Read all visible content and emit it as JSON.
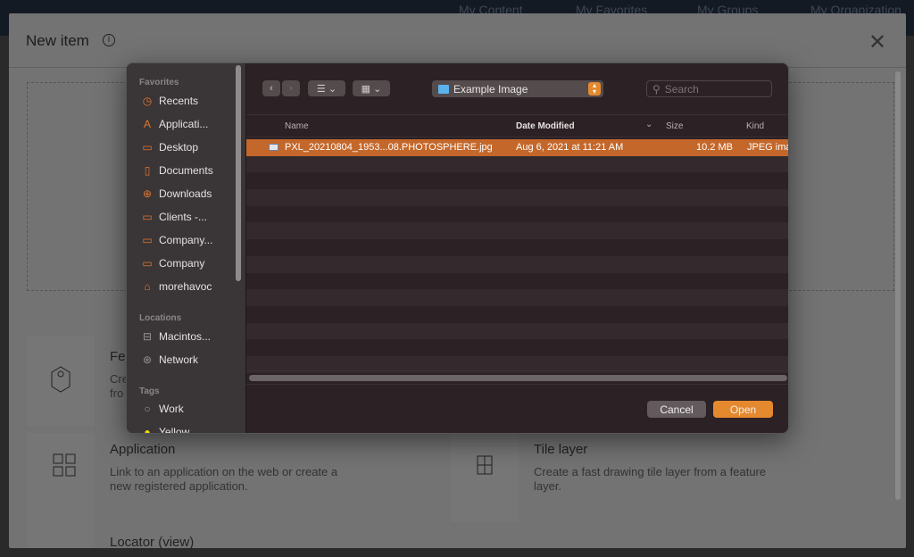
{
  "top_nav": [
    "My Content",
    "My Favorites",
    "My Groups",
    "My Organization"
  ],
  "modal": {
    "title": "New item",
    "info_icon": "info-icon",
    "close_icon": "close-icon",
    "cards": [
      {
        "title": "Fe",
        "desc": "Cre\nfro",
        "icon": "map-pin-icon"
      },
      {
        "title": "Application",
        "desc": "Link to an application on the web or create a new registered application.",
        "icon": "grid-icon"
      },
      {
        "title": "Tile layer",
        "desc": "Create a fast drawing tile layer from a feature layer.",
        "icon": "tile-map-icon"
      },
      {
        "title": "Locator (view)",
        "desc": "",
        "icon": "locator-icon"
      }
    ]
  },
  "file_dialog": {
    "sidebar": {
      "favorites_label": "Favorites",
      "favorites": [
        {
          "label": "Recents",
          "icon": "clock-icon"
        },
        {
          "label": "Applicati...",
          "icon": "applications-icon"
        },
        {
          "label": "Desktop",
          "icon": "desktop-icon"
        },
        {
          "label": "Documents",
          "icon": "document-icon"
        },
        {
          "label": "Downloads",
          "icon": "download-icon"
        },
        {
          "label": "Clients -...",
          "icon": "folder-icon"
        },
        {
          "label": "Company...",
          "icon": "folder-icon"
        },
        {
          "label": "Company",
          "icon": "folder-icon"
        },
        {
          "label": "morehavoc",
          "icon": "home-icon"
        }
      ],
      "locations_label": "Locations",
      "locations": [
        {
          "label": "Macintos...",
          "icon": "drive-icon"
        },
        {
          "label": "Network",
          "icon": "globe-icon"
        }
      ],
      "tags_label": "Tags",
      "tags": [
        {
          "label": "Work",
          "color": "#8c8586"
        },
        {
          "label": "Yellow",
          "color": "#f5d90a"
        }
      ]
    },
    "current_folder": "Example Image",
    "search_placeholder": "Search",
    "columns": [
      "Name",
      "Date Modified",
      "Size",
      "Kind"
    ],
    "files": [
      {
        "name": "PXL_20210804_1953...08.PHOTOSPHERE.jpg",
        "date": "Aug 6, 2021 at 11:21 AM",
        "size": "10.2 MB",
        "kind": "JPEG ima",
        "selected": true
      }
    ],
    "cancel_label": "Cancel",
    "open_label": "Open",
    "accent": "#e5892f"
  }
}
